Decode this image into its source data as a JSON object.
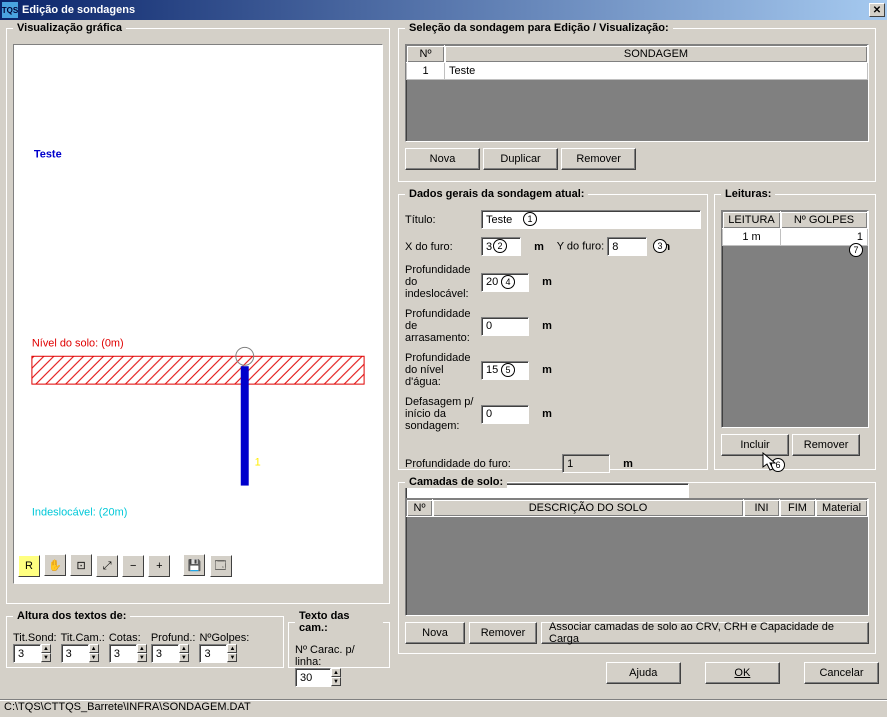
{
  "window": {
    "title": "Edição de sondagens"
  },
  "viz": {
    "legend": "Visualização gráfica",
    "big_title": "Teste",
    "level_label": "Nível do solo: (0m)",
    "indesloc_label": "Indeslocável: (20m)",
    "depth_tick": "1"
  },
  "toolbar": {
    "icons": [
      "R",
      "hand",
      "zoom-win",
      "zoom-ext",
      "zoom-out",
      "zoom-in",
      "save",
      "props"
    ]
  },
  "altura": {
    "legend": "Altura dos textos de:",
    "tit_sond": {
      "label": "Tit.Sond:",
      "value": "3"
    },
    "tit_cam": {
      "label": "Tit.Cam.:",
      "value": "3"
    },
    "cotas": {
      "label": "Cotas:",
      "value": "3"
    },
    "profund": {
      "label": "Profund.:",
      "value": "3"
    },
    "ngolpes": {
      "label": "NºGolpes:",
      "value": "3"
    }
  },
  "texto_cam": {
    "legend": "Texto das cam.:",
    "label": "Nº Carac. p/ linha:",
    "value": "30"
  },
  "selecao": {
    "legend": "Seleção da sondagem para Edição / Visualização:",
    "col_n": "Nº",
    "col_sond": "SONDAGEM",
    "rows": [
      {
        "n": "1",
        "name": "Teste"
      }
    ],
    "nova": "Nova",
    "duplicar": "Duplicar",
    "remover": "Remover"
  },
  "dados": {
    "legend": "Dados gerais da sondagem atual:",
    "titulo_label": "Título:",
    "titulo": "Teste",
    "xfuro_label": "X do furo:",
    "xfuro": "3",
    "yfuro_label": "Y do furo:",
    "yfuro": "8",
    "m": "m",
    "prof_indesloc_label": "Profundidade do indeslocável:",
    "prof_indesloc": "20",
    "prof_arrasa_label": "Profundidade de arrasamento:",
    "prof_arrasa": "0",
    "prof_agua_label": "Profundidade do nível d'água:",
    "prof_agua": "15",
    "defasagem_label": "Defasagem p/ início da sondagem:",
    "defasagem": "0",
    "prof_furo_label": "Profundidade do furo:",
    "prof_furo": "1",
    "note": ""
  },
  "leituras": {
    "legend": "Leituras:",
    "col_leit": "LEITURA",
    "col_golp": "Nº GOLPES",
    "rows": [
      {
        "leitura": "1 m",
        "golpes": "1"
      }
    ],
    "incluir": "Incluir",
    "remover": "Remover"
  },
  "camadas": {
    "legend": "Camadas de solo:",
    "col_n": "Nº",
    "col_desc": "DESCRIÇÃO DO SOLO",
    "col_ini": "INI",
    "col_fim": "FIM",
    "col_mat": "Material",
    "nova": "Nova",
    "remover": "Remover",
    "associar": "Associar camadas de solo ao CRV, CRH e Capacidade de Carga"
  },
  "footer": {
    "ajuda": "Ajuda",
    "ok": "OK",
    "cancelar": "Cancelar"
  },
  "status": "C:\\TQS\\CTTQS_Barrete\\INFRA\\SONDAGEM.DAT",
  "annotations": {
    "a1": "1",
    "a2": "2",
    "a3": "3",
    "a4": "4",
    "a5": "5",
    "a6": "6",
    "a7": "7"
  }
}
